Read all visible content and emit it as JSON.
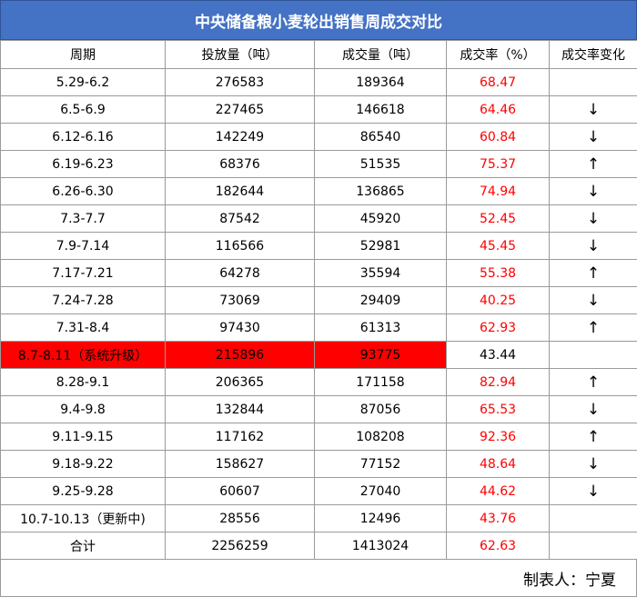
{
  "title": "中央储备粮小麦轮出销售周成交对比",
  "headers": [
    "周期",
    "投放量（吨）",
    "成交量（吨）",
    "成交率（%）",
    "成交率变化"
  ],
  "rows": [
    {
      "period": "5.29-6.2",
      "supply": "276583",
      "volume": "189364",
      "rate": "68.47",
      "change": ""
    },
    {
      "period": "6.5-6.9",
      "supply": "227465",
      "volume": "146618",
      "rate": "64.46",
      "change": "↓"
    },
    {
      "period": "6.12-6.16",
      "supply": "142249",
      "volume": "86540",
      "rate": "60.84",
      "change": "↓"
    },
    {
      "period": "6.19-6.23",
      "supply": "68376",
      "volume": "51535",
      "rate": "75.37",
      "change": "↑"
    },
    {
      "period": "6.26-6.30",
      "supply": "182644",
      "volume": "136865",
      "rate": "74.94",
      "change": "↓"
    },
    {
      "period": "7.3-7.7",
      "supply": "87542",
      "volume": "45920",
      "rate": "52.45",
      "change": "↓"
    },
    {
      "period": "7.9-7.14",
      "supply": "116566",
      "volume": "52981",
      "rate": "45.45",
      "change": "↓"
    },
    {
      "period": "7.17-7.21",
      "supply": "64278",
      "volume": "35594",
      "rate": "55.38",
      "change": "↑"
    },
    {
      "period": "7.24-7.28",
      "supply": "73069",
      "volume": "29409",
      "rate": "40.25",
      "change": "↓"
    },
    {
      "period": "7.31-8.4",
      "supply": "97430",
      "volume": "61313",
      "rate": "62.93",
      "change": "↑"
    },
    {
      "period": "8.7-8.11（系统升级）",
      "supply": "215896",
      "volume": "93775",
      "rate": "43.44",
      "change": ""
    },
    {
      "period": "8.28-9.1",
      "supply": "206365",
      "volume": "171158",
      "rate": "82.94",
      "change": "↑"
    },
    {
      "period": "9.4-9.8",
      "supply": "132844",
      "volume": "87056",
      "rate": "65.53",
      "change": "↓"
    },
    {
      "period": "9.11-9.15",
      "supply": "117162",
      "volume": "108208",
      "rate": "92.36",
      "change": "↑"
    },
    {
      "period": "9.18-9.22",
      "supply": "158627",
      "volume": "77152",
      "rate": "48.64",
      "change": "↓"
    },
    {
      "period": "9.25-9.28",
      "supply": "60607",
      "volume": "27040",
      "rate": "44.62",
      "change": "↓"
    },
    {
      "period": "10.7-10.13（更新中)",
      "supply": "28556",
      "volume": "12496",
      "rate": "43.76",
      "change": ""
    },
    {
      "period": "合计",
      "supply": "2256259",
      "volume": "1413024",
      "rate": "62.63",
      "change": ""
    }
  ],
  "highlight_row": 10,
  "neutral_rate_rows": [
    10
  ],
  "colors": {
    "header_bg": "#4472c4",
    "highlight": "#ff0000",
    "rate_text": "#ff0000"
  },
  "footer": "制表人：宁夏"
}
